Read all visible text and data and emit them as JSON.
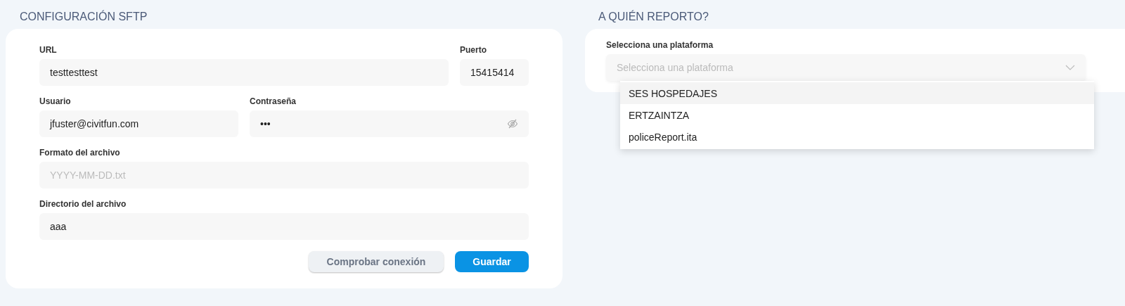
{
  "sftp": {
    "title": "CONFIGURACIÓN SFTP",
    "fields": [
      {
        "label": "URL",
        "value": "testtesttest",
        "kind": "text"
      },
      {
        "label": "Puerto",
        "value": "15415414",
        "kind": "text"
      },
      {
        "label": "Usuario",
        "value": "jfuster@civitfun.com",
        "kind": "text"
      },
      {
        "label": "Contraseña",
        "value": "•••",
        "kind": "password"
      },
      {
        "label": "Formato del archivo",
        "placeholder": "YYYY-MM-DD.txt",
        "kind": "text"
      },
      {
        "label": "Directorio del archivo",
        "value": "aaa",
        "kind": "text"
      }
    ],
    "buttons": [
      {
        "label": "Comprobar conexión",
        "kind": "secondary"
      },
      {
        "label": "Guardar",
        "kind": "primary"
      }
    ]
  },
  "report": {
    "title": "A QUIÉN REPORTO?",
    "select": {
      "label": "Selecciona una plataforma",
      "placeholder": "Selecciona una plataforma",
      "expanded": true,
      "options": [
        {
          "label": "SES HOSPEDAJES",
          "highlighted": true
        },
        {
          "label": "ERTZAINTZA",
          "highlighted": false
        },
        {
          "label": "policeReport.ita",
          "highlighted": false
        }
      ]
    }
  }
}
